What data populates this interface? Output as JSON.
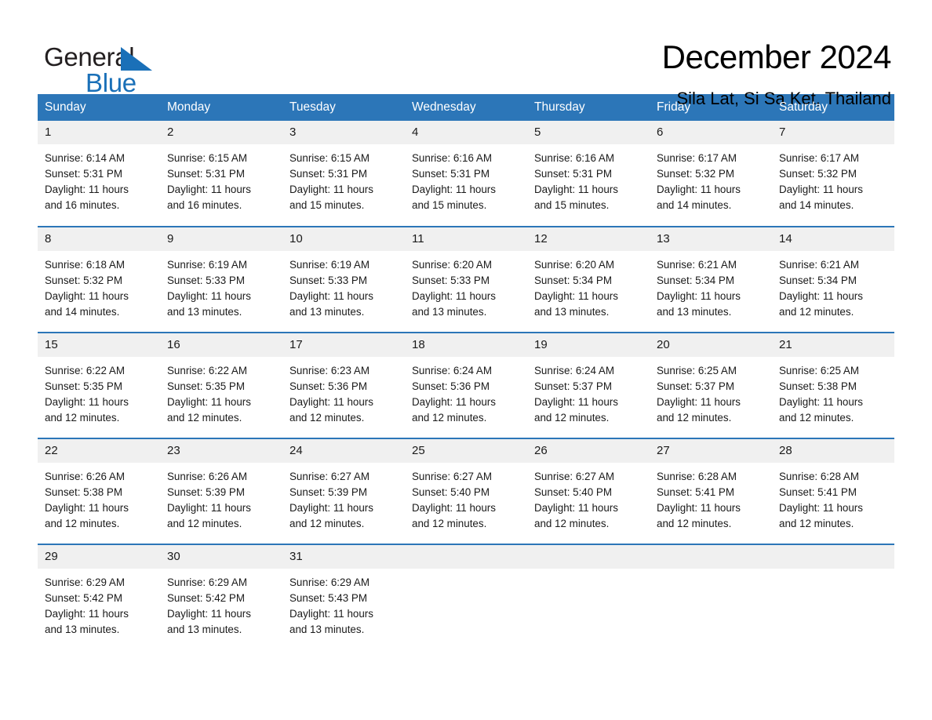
{
  "brand": {
    "name_part1": "General",
    "name_part2": "Blue",
    "accent_color": "#1a70b8",
    "header_color": "#2c76b8"
  },
  "header": {
    "title": "December 2024",
    "location": "Sila Lat, Si Sa Ket, Thailand"
  },
  "calendar": {
    "weekday_headers": [
      "Sunday",
      "Monday",
      "Tuesday",
      "Wednesday",
      "Thursday",
      "Friday",
      "Saturday"
    ],
    "weeks": [
      [
        {
          "day": "1",
          "sunrise": "Sunrise: 6:14 AM",
          "sunset": "Sunset: 5:31 PM",
          "daylight_line1": "Daylight: 11 hours",
          "daylight_line2": "and 16 minutes."
        },
        {
          "day": "2",
          "sunrise": "Sunrise: 6:15 AM",
          "sunset": "Sunset: 5:31 PM",
          "daylight_line1": "Daylight: 11 hours",
          "daylight_line2": "and 16 minutes."
        },
        {
          "day": "3",
          "sunrise": "Sunrise: 6:15 AM",
          "sunset": "Sunset: 5:31 PM",
          "daylight_line1": "Daylight: 11 hours",
          "daylight_line2": "and 15 minutes."
        },
        {
          "day": "4",
          "sunrise": "Sunrise: 6:16 AM",
          "sunset": "Sunset: 5:31 PM",
          "daylight_line1": "Daylight: 11 hours",
          "daylight_line2": "and 15 minutes."
        },
        {
          "day": "5",
          "sunrise": "Sunrise: 6:16 AM",
          "sunset": "Sunset: 5:31 PM",
          "daylight_line1": "Daylight: 11 hours",
          "daylight_line2": "and 15 minutes."
        },
        {
          "day": "6",
          "sunrise": "Sunrise: 6:17 AM",
          "sunset": "Sunset: 5:32 PM",
          "daylight_line1": "Daylight: 11 hours",
          "daylight_line2": "and 14 minutes."
        },
        {
          "day": "7",
          "sunrise": "Sunrise: 6:17 AM",
          "sunset": "Sunset: 5:32 PM",
          "daylight_line1": "Daylight: 11 hours",
          "daylight_line2": "and 14 minutes."
        }
      ],
      [
        {
          "day": "8",
          "sunrise": "Sunrise: 6:18 AM",
          "sunset": "Sunset: 5:32 PM",
          "daylight_line1": "Daylight: 11 hours",
          "daylight_line2": "and 14 minutes."
        },
        {
          "day": "9",
          "sunrise": "Sunrise: 6:19 AM",
          "sunset": "Sunset: 5:33 PM",
          "daylight_line1": "Daylight: 11 hours",
          "daylight_line2": "and 13 minutes."
        },
        {
          "day": "10",
          "sunrise": "Sunrise: 6:19 AM",
          "sunset": "Sunset: 5:33 PM",
          "daylight_line1": "Daylight: 11 hours",
          "daylight_line2": "and 13 minutes."
        },
        {
          "day": "11",
          "sunrise": "Sunrise: 6:20 AM",
          "sunset": "Sunset: 5:33 PM",
          "daylight_line1": "Daylight: 11 hours",
          "daylight_line2": "and 13 minutes."
        },
        {
          "day": "12",
          "sunrise": "Sunrise: 6:20 AM",
          "sunset": "Sunset: 5:34 PM",
          "daylight_line1": "Daylight: 11 hours",
          "daylight_line2": "and 13 minutes."
        },
        {
          "day": "13",
          "sunrise": "Sunrise: 6:21 AM",
          "sunset": "Sunset: 5:34 PM",
          "daylight_line1": "Daylight: 11 hours",
          "daylight_line2": "and 13 minutes."
        },
        {
          "day": "14",
          "sunrise": "Sunrise: 6:21 AM",
          "sunset": "Sunset: 5:34 PM",
          "daylight_line1": "Daylight: 11 hours",
          "daylight_line2": "and 12 minutes."
        }
      ],
      [
        {
          "day": "15",
          "sunrise": "Sunrise: 6:22 AM",
          "sunset": "Sunset: 5:35 PM",
          "daylight_line1": "Daylight: 11 hours",
          "daylight_line2": "and 12 minutes."
        },
        {
          "day": "16",
          "sunrise": "Sunrise: 6:22 AM",
          "sunset": "Sunset: 5:35 PM",
          "daylight_line1": "Daylight: 11 hours",
          "daylight_line2": "and 12 minutes."
        },
        {
          "day": "17",
          "sunrise": "Sunrise: 6:23 AM",
          "sunset": "Sunset: 5:36 PM",
          "daylight_line1": "Daylight: 11 hours",
          "daylight_line2": "and 12 minutes."
        },
        {
          "day": "18",
          "sunrise": "Sunrise: 6:24 AM",
          "sunset": "Sunset: 5:36 PM",
          "daylight_line1": "Daylight: 11 hours",
          "daylight_line2": "and 12 minutes."
        },
        {
          "day": "19",
          "sunrise": "Sunrise: 6:24 AM",
          "sunset": "Sunset: 5:37 PM",
          "daylight_line1": "Daylight: 11 hours",
          "daylight_line2": "and 12 minutes."
        },
        {
          "day": "20",
          "sunrise": "Sunrise: 6:25 AM",
          "sunset": "Sunset: 5:37 PM",
          "daylight_line1": "Daylight: 11 hours",
          "daylight_line2": "and 12 minutes."
        },
        {
          "day": "21",
          "sunrise": "Sunrise: 6:25 AM",
          "sunset": "Sunset: 5:38 PM",
          "daylight_line1": "Daylight: 11 hours",
          "daylight_line2": "and 12 minutes."
        }
      ],
      [
        {
          "day": "22",
          "sunrise": "Sunrise: 6:26 AM",
          "sunset": "Sunset: 5:38 PM",
          "daylight_line1": "Daylight: 11 hours",
          "daylight_line2": "and 12 minutes."
        },
        {
          "day": "23",
          "sunrise": "Sunrise: 6:26 AM",
          "sunset": "Sunset: 5:39 PM",
          "daylight_line1": "Daylight: 11 hours",
          "daylight_line2": "and 12 minutes."
        },
        {
          "day": "24",
          "sunrise": "Sunrise: 6:27 AM",
          "sunset": "Sunset: 5:39 PM",
          "daylight_line1": "Daylight: 11 hours",
          "daylight_line2": "and 12 minutes."
        },
        {
          "day": "25",
          "sunrise": "Sunrise: 6:27 AM",
          "sunset": "Sunset: 5:40 PM",
          "daylight_line1": "Daylight: 11 hours",
          "daylight_line2": "and 12 minutes."
        },
        {
          "day": "26",
          "sunrise": "Sunrise: 6:27 AM",
          "sunset": "Sunset: 5:40 PM",
          "daylight_line1": "Daylight: 11 hours",
          "daylight_line2": "and 12 minutes."
        },
        {
          "day": "27",
          "sunrise": "Sunrise: 6:28 AM",
          "sunset": "Sunset: 5:41 PM",
          "daylight_line1": "Daylight: 11 hours",
          "daylight_line2": "and 12 minutes."
        },
        {
          "day": "28",
          "sunrise": "Sunrise: 6:28 AM",
          "sunset": "Sunset: 5:41 PM",
          "daylight_line1": "Daylight: 11 hours",
          "daylight_line2": "and 12 minutes."
        }
      ],
      [
        {
          "day": "29",
          "sunrise": "Sunrise: 6:29 AM",
          "sunset": "Sunset: 5:42 PM",
          "daylight_line1": "Daylight: 11 hours",
          "daylight_line2": "and 13 minutes."
        },
        {
          "day": "30",
          "sunrise": "Sunrise: 6:29 AM",
          "sunset": "Sunset: 5:42 PM",
          "daylight_line1": "Daylight: 11 hours",
          "daylight_line2": "and 13 minutes."
        },
        {
          "day": "31",
          "sunrise": "Sunrise: 6:29 AM",
          "sunset": "Sunset: 5:43 PM",
          "daylight_line1": "Daylight: 11 hours",
          "daylight_line2": "and 13 minutes."
        },
        {
          "day": "",
          "sunrise": "",
          "sunset": "",
          "daylight_line1": "",
          "daylight_line2": ""
        },
        {
          "day": "",
          "sunrise": "",
          "sunset": "",
          "daylight_line1": "",
          "daylight_line2": ""
        },
        {
          "day": "",
          "sunrise": "",
          "sunset": "",
          "daylight_line1": "",
          "daylight_line2": ""
        },
        {
          "day": "",
          "sunrise": "",
          "sunset": "",
          "daylight_line1": "",
          "daylight_line2": ""
        }
      ]
    ]
  }
}
